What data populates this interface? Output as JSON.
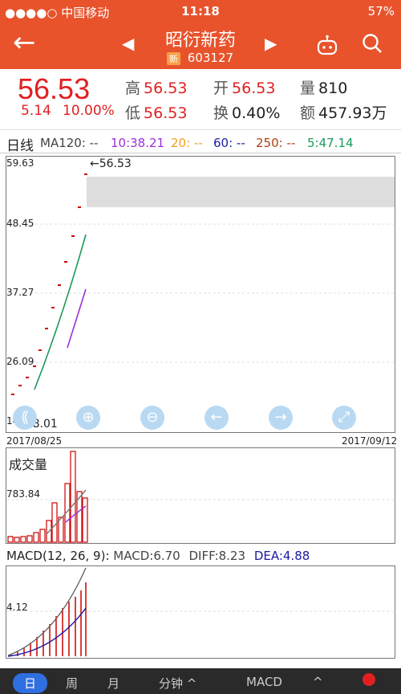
{
  "status": {
    "carrier": "●●●●○ 中国移动",
    "time": "11:18",
    "battery": "57%"
  },
  "nav": {
    "title": "昭衍新药",
    "badge": "新",
    "code": "603127"
  },
  "quote": {
    "price": "56.53",
    "change": "5.14",
    "change_pct": "10.00%",
    "high_label": "高",
    "high": "56.53",
    "open_label": "开",
    "open": "56.53",
    "vol_label": "量",
    "vol": "810",
    "low_label": "低",
    "low": "56.53",
    "turn_label": "换",
    "turn": "0.40%",
    "amt_label": "额",
    "amt": "457.93万"
  },
  "ma": {
    "period": "日线",
    "ma120": "MA120: --",
    "ma10": "10:38.21",
    "ma20": "20: --",
    "ma60": "60: --",
    "ma250": "250: --",
    "ma5": "5:47.14",
    "colors": {
      "ma10": "#9b30d9",
      "ma20": "#f0a020",
      "ma60": "#1a1aa0",
      "ma250": "#b04010",
      "ma5": "#1a9a5a"
    }
  },
  "kline": {
    "y_ticks": [
      "59.63",
      "48.45",
      "37.27",
      "26.09",
      "14.91"
    ],
    "max_label": "←56.53",
    "min_label": "←18.01",
    "date_start": "2017/08/25",
    "date_end": "2017/09/12"
  },
  "volume": {
    "title": "成交量",
    "tick": "783.84"
  },
  "macd": {
    "title": "MACD(12, 26, 9):",
    "macd": "MACD:6.70",
    "diff": "DIFF:8.23",
    "dea": "DEA:4.88",
    "tick": "4.12"
  },
  "tabs": [
    "日",
    "周",
    "月",
    "分钟 ^",
    "MACD",
    "^"
  ],
  "chart_data": {
    "type": "line",
    "x": [
      "2017/08/25",
      "2017/09/12"
    ],
    "series": [
      {
        "name": "5",
        "values": [
          47.14
        ]
      },
      {
        "name": "10",
        "values": [
          38.21
        ]
      }
    ],
    "ylim": [
      14.91,
      59.63
    ]
  }
}
